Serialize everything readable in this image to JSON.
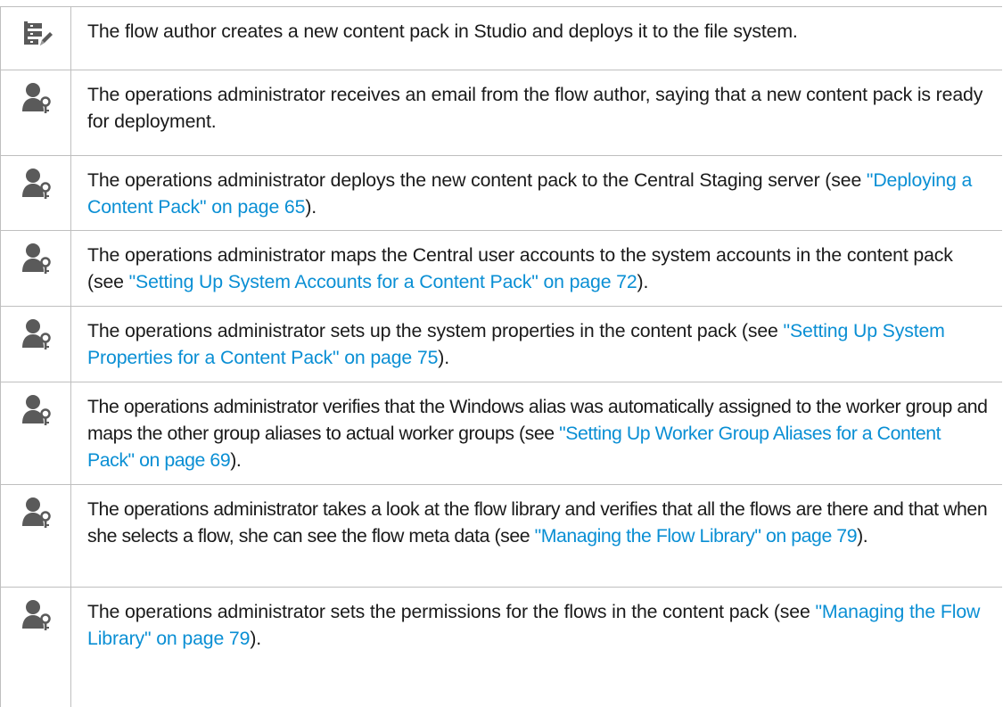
{
  "rows": [
    {
      "icon": "flow-author-icon",
      "parts": [
        "The flow author creates a new content pack in Studio and deploys it to the file system.",
        "",
        ""
      ]
    },
    {
      "icon": "operations-admin-icon",
      "parts": [
        "The operations administrator receives an email from the flow author, saying that a new content pack is ready for deployment.",
        "",
        ""
      ]
    },
    {
      "icon": "operations-admin-icon",
      "parts": [
        "The operations administrator deploys the new content pack to the Central Staging server (see ",
        "\"Deploying a Content Pack\" on page 65",
        ")."
      ]
    },
    {
      "icon": "operations-admin-icon",
      "parts": [
        "The operations administrator maps the Central user accounts to the system accounts in the content pack (see ",
        "\"Setting Up System Accounts for a Content Pack\" on page 72",
        ")."
      ]
    },
    {
      "icon": "operations-admin-icon",
      "parts": [
        "The operations administrator sets up the system properties in the content pack (see ",
        "\"Setting Up System Properties for a Content Pack\" on page 75",
        ")."
      ]
    },
    {
      "icon": "operations-admin-icon",
      "parts": [
        "The operations administrator verifies that the Windows alias was automatically assigned to the worker group and maps the other group aliases to actual worker groups (see ",
        "\"Setting Up Worker Group Aliases for a Content Pack\" on page 69",
        ")."
      ]
    },
    {
      "icon": "operations-admin-icon",
      "parts": [
        "The operations administrator takes a look at the flow library and verifies that all the flows are there and that when she selects a flow, she can see the flow meta data (see ",
        "\"Managing the Flow Library\" on page 79",
        ")."
      ]
    },
    {
      "icon": "operations-admin-icon",
      "parts": [
        "The operations administrator sets the permissions for the flows in the content pack (see ",
        "\"Managing the Flow Library\" on page 79",
        ")."
      ]
    }
  ]
}
